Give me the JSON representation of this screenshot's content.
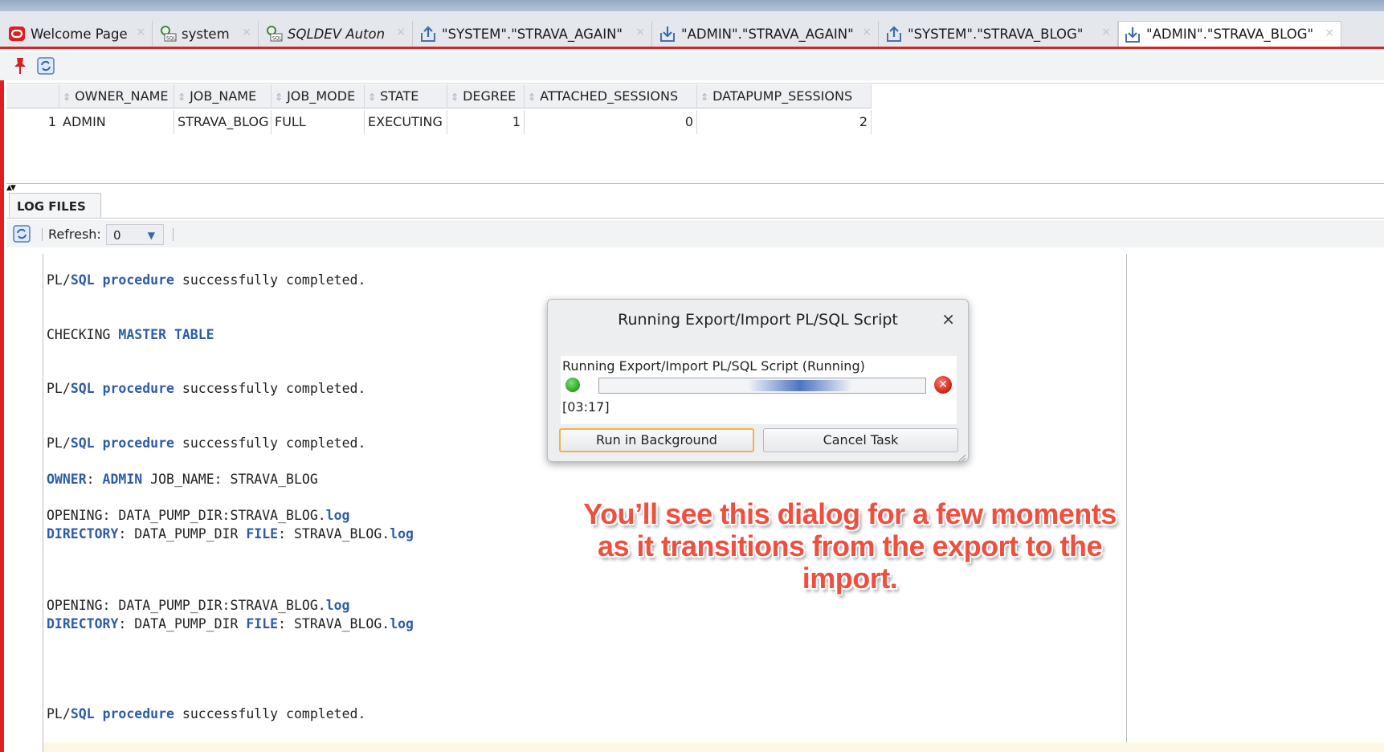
{
  "tabs": [
    {
      "label": "Welcome Page",
      "icon": "oracle-icon"
    },
    {
      "label": "system",
      "icon": "sql-connection-icon"
    },
    {
      "label": "SQLDEV Auton",
      "icon": "sql-connection-icon"
    },
    {
      "label": "\"SYSTEM\".\"STRAVA_AGAIN\"",
      "icon": "export-icon"
    },
    {
      "label": "\"ADMIN\".\"STRAVA_AGAIN\"",
      "icon": "import-icon"
    },
    {
      "label": "\"SYSTEM\".\"STRAVA_BLOG\"",
      "icon": "export-icon"
    },
    {
      "label": "\"ADMIN\".\"STRAVA_BLOG\"",
      "icon": "import-icon"
    }
  ],
  "tab_close_glyph": "×",
  "grid": {
    "columns": [
      "OWNER_NAME",
      "JOB_NAME",
      "JOB_MODE",
      "STATE",
      "DEGREE",
      "ATTACHED_SESSIONS",
      "DATAPUMP_SESSIONS"
    ],
    "rows": [
      {
        "n": "1",
        "owner_name": "ADMIN",
        "job_name": "STRAVA_BLOG",
        "job_mode": "FULL",
        "state": "EXECUTING",
        "degree": "1",
        "attached_sessions": "0",
        "datapump_sessions": "2"
      }
    ]
  },
  "log_panel": {
    "tab_label": "LOG FILES",
    "refresh_label": "Refresh:",
    "refresh_value": "0"
  },
  "log": {
    "l1": {
      "a": "PL/",
      "b": "SQL",
      "c": " ",
      "d": "procedure",
      "e": " successfully completed."
    },
    "l2": {
      "a": "CHECKING ",
      "b": "MASTER TABLE"
    },
    "l3": {
      "a": "PL/",
      "b": "SQL",
      "c": " ",
      "d": "procedure",
      "e": " successfully completed."
    },
    "l4": {
      "a": "PL/",
      "b": "SQL",
      "c": " ",
      "d": "procedure",
      "e": " successfully completed."
    },
    "l5": {
      "a": "OWNER",
      "b": ": ",
      "c": "ADMIN",
      "d": " JOB_NAME: STRAVA_BLOG"
    },
    "l6": {
      "a": "OPENING: DATA_PUMP_DIR:STRAVA_BLOG.",
      "b": "log"
    },
    "l7": {
      "a": "DIRECTORY",
      "b": ": DATA_PUMP_DIR ",
      "c": "FILE",
      "d": ": STRAVA_BLOG.",
      "e": "log"
    },
    "l8": {
      "a": "OPENING: DATA_PUMP_DIR:STRAVA_BLOG.",
      "b": "log"
    },
    "l9": {
      "a": "DIRECTORY",
      "b": ": DATA_PUMP_DIR ",
      "c": "FILE",
      "d": ": STRAVA_BLOG.",
      "e": "log"
    },
    "l10": {
      "a": "PL/",
      "b": "SQL",
      "c": " ",
      "d": "procedure",
      "e": " successfully completed."
    }
  },
  "dialog": {
    "title": "Running Export/Import PL/SQL Script",
    "close": "×",
    "status": "Running Export/Import PL/SQL Script (Running)",
    "elapsed": "[03:17]",
    "run_background_label": "Run in Background",
    "cancel_label": "Cancel Task"
  },
  "annotation": {
    "line1": "You’ll see this dialog for a few moments",
    "line2": "as it transitions from the export to the",
    "line3": "import."
  },
  "colors": {
    "accent_red": "#e02020",
    "keyword_blue": "#2d5ca6",
    "callout_red": "#f04e3e",
    "default_button_border": "#f1b24a"
  }
}
